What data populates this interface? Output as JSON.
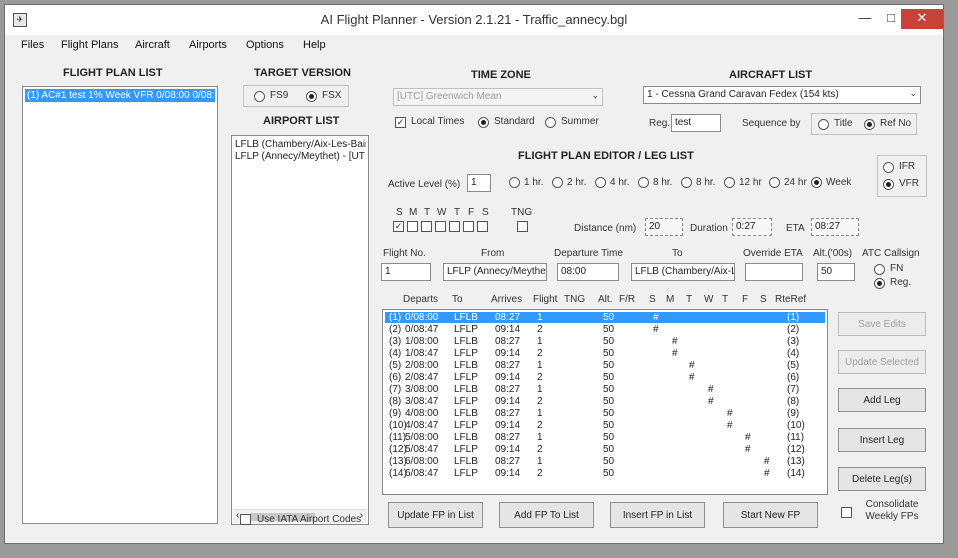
{
  "window": {
    "title": "AI Flight Planner - Version 2.1.21 - Traffic_annecy.bgl"
  },
  "menu": [
    "Files",
    "Flight Plans",
    "Aircraft",
    "Airports",
    "Options",
    "Help"
  ],
  "flight_plan_list": {
    "heading": "FLIGHT PLAN LIST",
    "items": [
      "(1) AC#1 test 1% Week VFR 0/08:00 0/08:0"
    ]
  },
  "target_version": {
    "heading": "TARGET VERSION",
    "options": [
      "FS9",
      "FSX"
    ],
    "selected": "FSX"
  },
  "airport_list": {
    "heading": "AIRPORT LIST",
    "items": [
      "LFLB (Chambery/Aix-Les-Bain",
      "LFLP (Annecy/Meythet) - [UT"
    ],
    "use_iata_label": "Use IATA Airport Codes"
  },
  "time_zone": {
    "heading": "TIME ZONE",
    "value": "[UTC] Greenwich Mean",
    "local_times_label": "Local Times",
    "local_times_checked": true,
    "standard_label": "Standard",
    "summer_label": "Summer",
    "selected": "Standard"
  },
  "aircraft_list": {
    "heading": "AIRCRAFT LIST",
    "selected": "1 - Cessna Grand Caravan Fedex (154 kts)",
    "reg_label": "Reg.",
    "reg_value": "test",
    "sequence_label": "Sequence by",
    "title_option": "Title",
    "refno_option": "Ref No",
    "sequence_selected": "Ref No"
  },
  "editor": {
    "heading": "FLIGHT PLAN EDITOR / LEG LIST",
    "active_level_label": "Active Level (%)",
    "active_level_value": "1",
    "intervals": [
      "1 hr.",
      "2 hr.",
      "4 hr.",
      "8 hr.",
      "8 hr.",
      "12 hr",
      "24 hr",
      "Week"
    ],
    "interval_selected": "Week",
    "rules": [
      "IFR",
      "VFR"
    ],
    "rules_selected": "VFR",
    "days_letters": [
      "S",
      "M",
      "T",
      "W",
      "T",
      "F",
      "S"
    ],
    "days_checked": [
      true,
      false,
      false,
      false,
      false,
      false,
      false
    ],
    "tng_label": "TNG",
    "distance_label": "Distance (nm)",
    "distance_value": "20",
    "duration_label": "Duration",
    "duration_value": "0:27",
    "eta_label": "ETA",
    "eta_value": "08:27",
    "flight_no_label": "Flight No.",
    "flight_no_value": "1",
    "from_label": "From",
    "from_value": "LFLP (Annecy/Meythe",
    "departure_label": "Departure Time",
    "departure_value": "08:00",
    "to_label": "To",
    "to_value": "LFLB (Chambery/Aix-L",
    "override_eta_label": "Override ETA",
    "override_eta_value": "",
    "alt_label": "Alt.('00s)",
    "alt_value": "50",
    "atc_label": "ATC Callsign",
    "atc_options": [
      "FN",
      "Reg."
    ],
    "atc_selected": "Reg."
  },
  "legs": {
    "headers": [
      "Departs",
      "To",
      "Arrives",
      "Flight",
      "TNG",
      "Alt.",
      "F/R",
      "S",
      "M",
      "T",
      "W",
      "T",
      "F",
      "S",
      "RteRef"
    ],
    "rows": [
      {
        "n": "(1)",
        "dep": "0/08:00",
        "to": "LFLB",
        "arr": "08:27",
        "flt": "1",
        "alt": "50",
        "day": 0,
        "ref": "(1)"
      },
      {
        "n": "(2)",
        "dep": "0/08:47",
        "to": "LFLP",
        "arr": "09:14",
        "flt": "2",
        "alt": "50",
        "day": 0,
        "ref": "(2)"
      },
      {
        "n": "(3)",
        "dep": "1/08:00",
        "to": "LFLB",
        "arr": "08:27",
        "flt": "1",
        "alt": "50",
        "day": 1,
        "ref": "(3)"
      },
      {
        "n": "(4)",
        "dep": "1/08:47",
        "to": "LFLP",
        "arr": "09:14",
        "flt": "2",
        "alt": "50",
        "day": 1,
        "ref": "(4)"
      },
      {
        "n": "(5)",
        "dep": "2/08:00",
        "to": "LFLB",
        "arr": "08:27",
        "flt": "1",
        "alt": "50",
        "day": 2,
        "ref": "(5)"
      },
      {
        "n": "(6)",
        "dep": "2/08:47",
        "to": "LFLP",
        "arr": "09:14",
        "flt": "2",
        "alt": "50",
        "day": 2,
        "ref": "(6)"
      },
      {
        "n": "(7)",
        "dep": "3/08:00",
        "to": "LFLB",
        "arr": "08:27",
        "flt": "1",
        "alt": "50",
        "day": 3,
        "ref": "(7)"
      },
      {
        "n": "(8)",
        "dep": "3/08:47",
        "to": "LFLP",
        "arr": "09:14",
        "flt": "2",
        "alt": "50",
        "day": 3,
        "ref": "(8)"
      },
      {
        "n": "(9)",
        "dep": "4/08:00",
        "to": "LFLB",
        "arr": "08:27",
        "flt": "1",
        "alt": "50",
        "day": 4,
        "ref": "(9)"
      },
      {
        "n": "(10)",
        "dep": "4/08:47",
        "to": "LFLP",
        "arr": "09:14",
        "flt": "2",
        "alt": "50",
        "day": 4,
        "ref": "(10)"
      },
      {
        "n": "(11)",
        "dep": "5/08:00",
        "to": "LFLB",
        "arr": "08:27",
        "flt": "1",
        "alt": "50",
        "day": 5,
        "ref": "(11)"
      },
      {
        "n": "(12)",
        "dep": "5/08:47",
        "to": "LFLP",
        "arr": "09:14",
        "flt": "2",
        "alt": "50",
        "day": 5,
        "ref": "(12)"
      },
      {
        "n": "(13)",
        "dep": "6/08:00",
        "to": "LFLB",
        "arr": "08:27",
        "flt": "1",
        "alt": "50",
        "day": 6,
        "ref": "(13)"
      },
      {
        "n": "(14)",
        "dep": "6/08:47",
        "to": "LFLP",
        "arr": "09:14",
        "flt": "2",
        "alt": "50",
        "day": 6,
        "ref": "(14)"
      }
    ],
    "mark": "#"
  },
  "side_buttons": {
    "save_edits": "Save Edits",
    "update_selected": "Update Selected",
    "add_leg": "Add Leg",
    "insert_leg": "Insert Leg",
    "delete_legs": "Delete Leg(s)",
    "consolidate": "Consolidate Weekly FPs"
  },
  "bottom_buttons": {
    "update_fp": "Update FP in List",
    "add_fp": "Add FP To List",
    "insert_fp": "Insert FP in List",
    "start_new": "Start New FP"
  },
  "colors": {
    "selection": "#3399ff",
    "close_button": "#c9423a"
  }
}
